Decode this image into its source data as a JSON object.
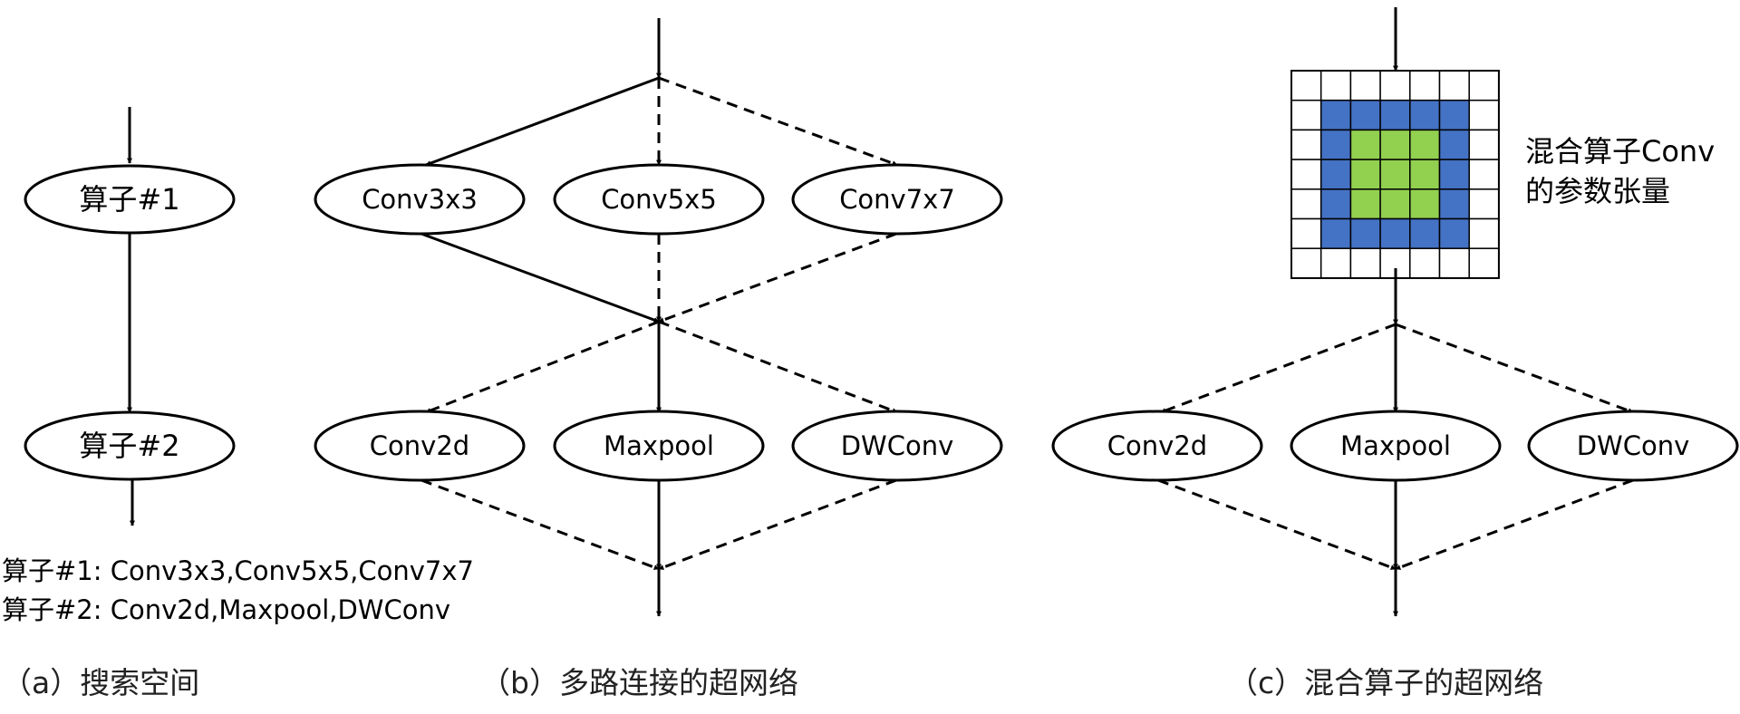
{
  "panel_a": {
    "nodes": [
      "算子#1",
      "算子#2"
    ],
    "legend": [
      "算子#1: Conv3x3,Conv5x5,Conv7x7",
      "算子#2: Conv2d,Maxpool,DWConv"
    ],
    "caption": "（a）搜索空间"
  },
  "panel_b": {
    "layer1": [
      "Conv3x3",
      "Conv5x5",
      "Conv7x7"
    ],
    "layer2": [
      "Conv2d",
      "Maxpool",
      "DWConv"
    ],
    "caption": "（b）多路连接的超网络"
  },
  "panel_c": {
    "tensor_label_line1": "混合算子Conv",
    "tensor_label_line2": "的参数张量",
    "layer": [
      "Conv2d",
      "Maxpool",
      "DWConv"
    ],
    "caption": "（c）混合算子的超网络",
    "colors": {
      "outer_ring": "#4472C4",
      "inner_block": "#92D050",
      "cell_border": "#000000"
    }
  }
}
